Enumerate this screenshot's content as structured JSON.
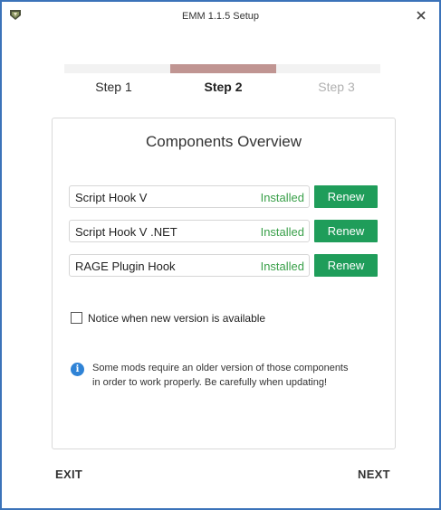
{
  "window": {
    "title": "EMM 1.1.5 Setup"
  },
  "colors": {
    "progress_done": "#f2f2f2",
    "progress_active": "#c09592",
    "progress_pending": "#f2f2f2",
    "step_active": "#222222",
    "step_inactive": "#2b2b2b",
    "step_pending": "#b0b0b0",
    "installed": "#3aa04a",
    "renew": "#1f9d5a",
    "info": "#2f83d6"
  },
  "steps": [
    {
      "label": "Step 1",
      "state": "done"
    },
    {
      "label": "Step 2",
      "state": "active"
    },
    {
      "label": "Step 3",
      "state": "pending"
    }
  ],
  "panel": {
    "title": "Components Overview"
  },
  "components": [
    {
      "name": "Script Hook V",
      "status": "Installed",
      "action": "Renew"
    },
    {
      "name": "Script Hook V .NET",
      "status": "Installed",
      "action": "Renew"
    },
    {
      "name": "RAGE Plugin Hook",
      "status": "Installed",
      "action": "Renew"
    }
  ],
  "notice": {
    "label": "Notice when new version is available",
    "checked": false
  },
  "info": {
    "line1": "Some mods require an older version of those components",
    "line2": "in order to work properly. Be carefully when updating!"
  },
  "footer": {
    "exit_label": "EXIT",
    "next_label": "NEXT"
  }
}
